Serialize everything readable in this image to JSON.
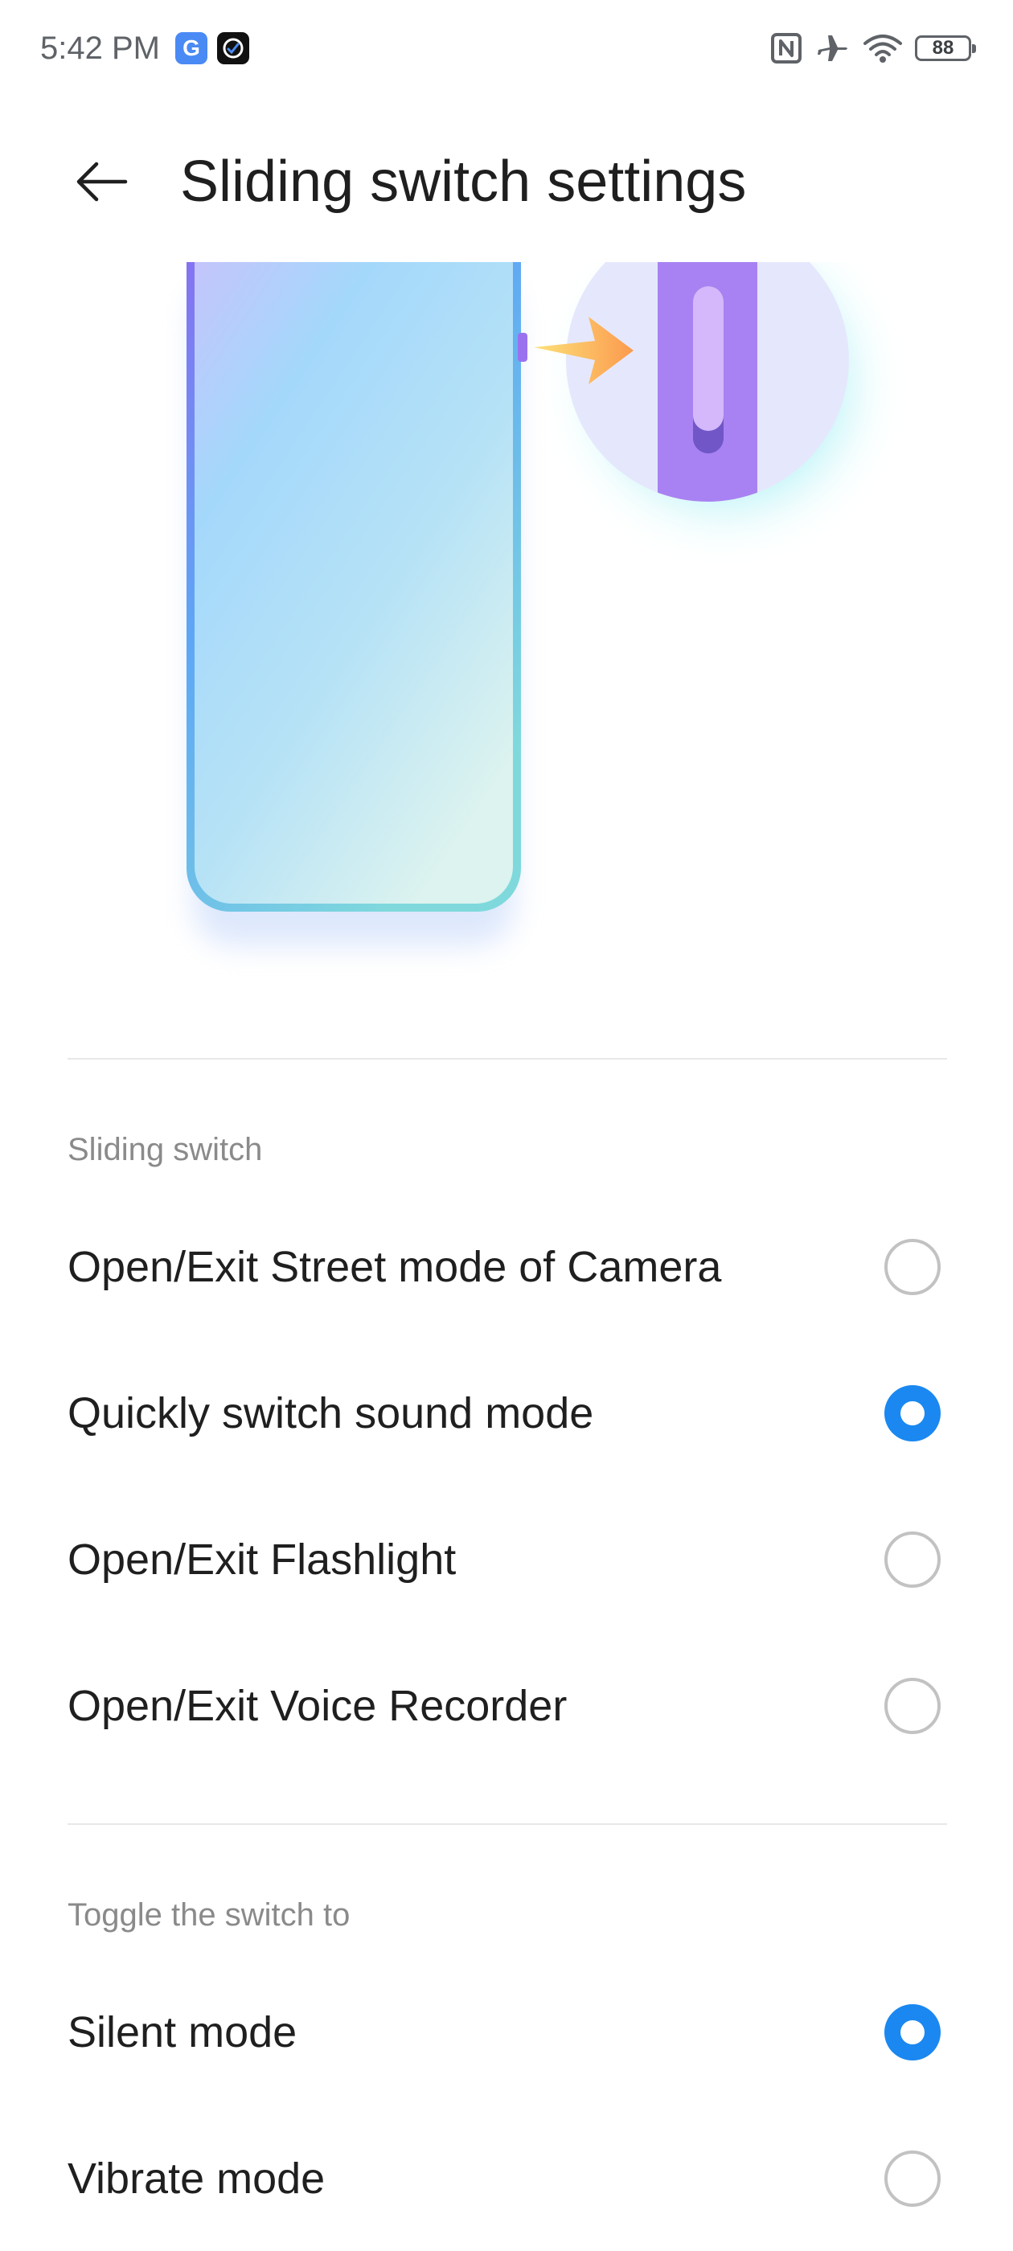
{
  "status_bar": {
    "time": "5:42 PM",
    "app_icons": [
      "google-app-icon",
      "notification-app-icon"
    ],
    "right_icons": [
      "nfc-icon",
      "airplane-mode-icon",
      "wifi-icon",
      "battery-icon"
    ],
    "battery_level": "88"
  },
  "header": {
    "back_icon": "back-arrow-icon",
    "title": "Sliding switch settings"
  },
  "sections": [
    {
      "title": "Sliding switch",
      "options": [
        {
          "label": "Open/Exit Street mode of Camera",
          "selected": false
        },
        {
          "label": "Quickly switch sound mode",
          "selected": true
        },
        {
          "label": "Open/Exit Flashlight",
          "selected": false
        },
        {
          "label": "Open/Exit Voice Recorder",
          "selected": false
        }
      ]
    },
    {
      "title": "Toggle the switch to",
      "options": [
        {
          "label": "Silent mode",
          "selected": true
        },
        {
          "label": "Vibrate mode",
          "selected": false
        }
      ]
    }
  ],
  "colors": {
    "accent": "#1a88f0",
    "radio_unchecked": "#c2c2c2",
    "section_header": "#8a8a8a",
    "divider": "#e8e8e8"
  }
}
